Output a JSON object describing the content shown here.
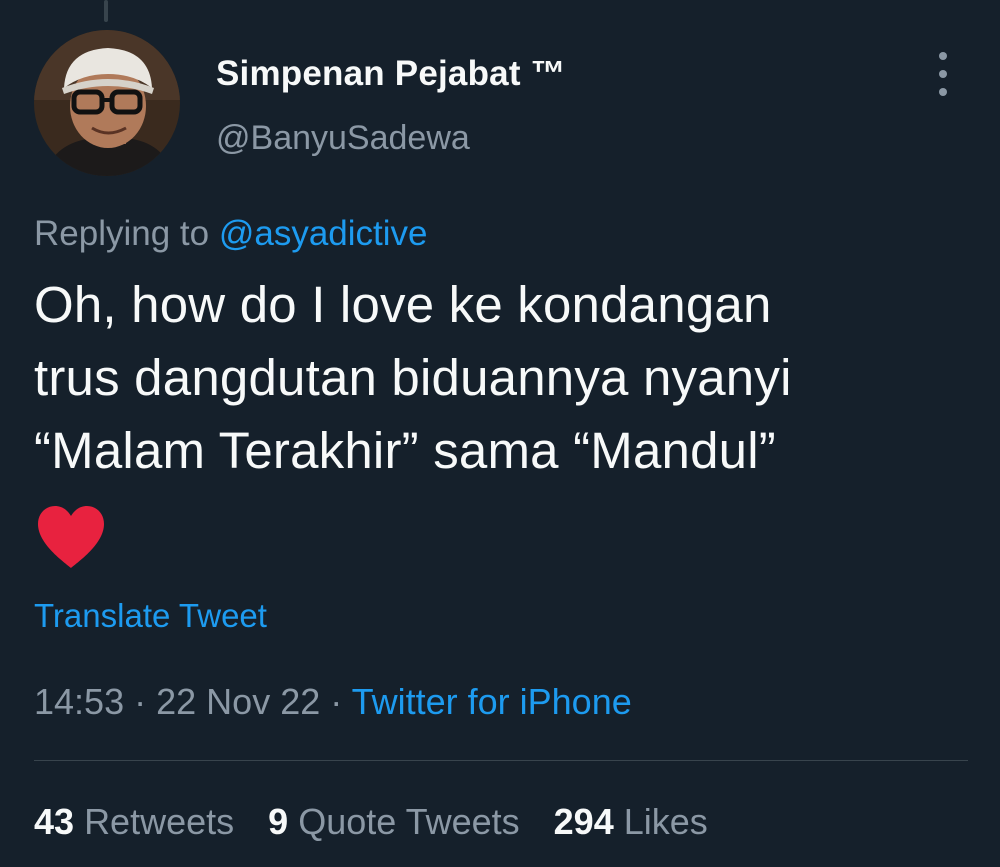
{
  "colors": {
    "background": "#15202b",
    "primary_text": "#f7f9f9",
    "secondary_text": "#8b98a5",
    "link": "#1d9bf0",
    "divider": "#38444d",
    "heart": "#e8223f"
  },
  "author": {
    "display_name": "Simpenan Pejabat ™",
    "handle": "@BanyuSadewa",
    "avatar_icon": "profile-photo"
  },
  "reply": {
    "prefix": "Replying to",
    "mention": "@asyadictive"
  },
  "tweet": {
    "lines": [
      "Oh, how do I love ke kondangan",
      "trus dangdutan biduannya nyanyi",
      "“Malam Terakhir” sama “Mandul”"
    ],
    "emoji": "heart-icon"
  },
  "translate_label": "Translate Tweet",
  "meta": {
    "time": "14:53",
    "separator": "·",
    "date": "22 Nov 22",
    "source": "Twitter for iPhone"
  },
  "stats": {
    "retweets_count": "43",
    "retweets_label": "Retweets",
    "quotes_count": "9",
    "quotes_label": "Quote Tweets",
    "likes_count": "294",
    "likes_label": "Likes"
  }
}
